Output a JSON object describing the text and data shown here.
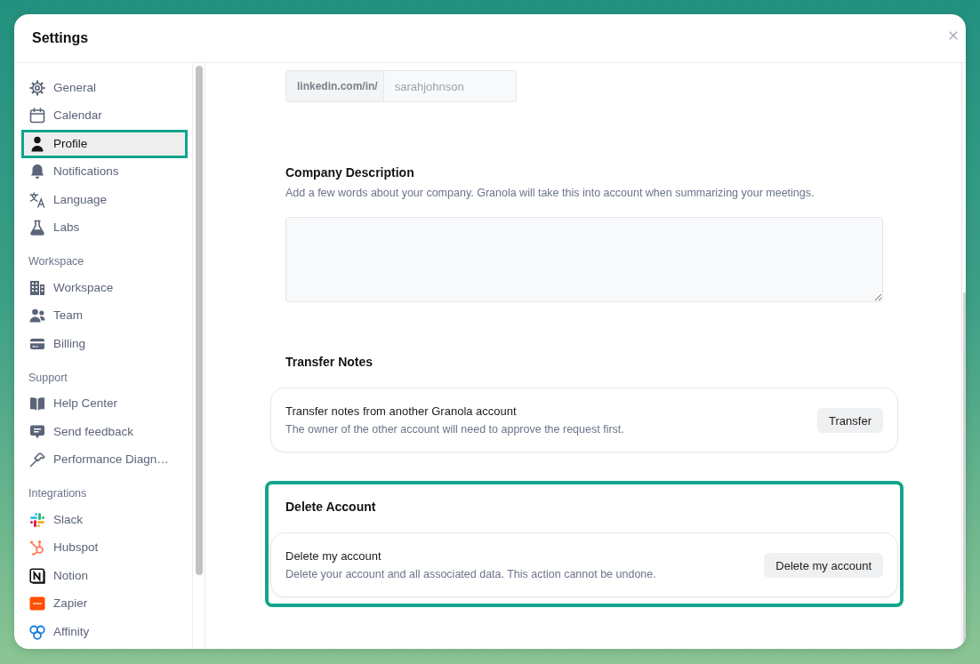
{
  "window": {
    "title": "Settings"
  },
  "sidebar": {
    "sections": [
      {
        "items": [
          {
            "label": "General",
            "selected": false,
            "highlighted": false
          },
          {
            "label": "Calendar",
            "selected": false,
            "highlighted": false
          },
          {
            "label": "Profile",
            "selected": true,
            "highlighted": true
          },
          {
            "label": "Notifications",
            "selected": false,
            "highlighted": false
          },
          {
            "label": "Language",
            "selected": false,
            "highlighted": false
          },
          {
            "label": "Labs",
            "selected": false,
            "highlighted": false
          }
        ]
      },
      {
        "heading": "Workspace",
        "items": [
          {
            "label": "Workspace",
            "selected": false,
            "highlighted": false
          },
          {
            "label": "Team",
            "selected": false,
            "highlighted": false
          },
          {
            "label": "Billing",
            "selected": false,
            "highlighted": false
          }
        ]
      },
      {
        "heading": "Support",
        "items": [
          {
            "label": "Help Center",
            "selected": false,
            "highlighted": false
          },
          {
            "label": "Send feedback",
            "selected": false,
            "highlighted": false
          },
          {
            "label": "Performance Diagn…",
            "selected": false,
            "highlighted": false
          }
        ]
      },
      {
        "heading": "Integrations",
        "items": [
          {
            "label": "Slack",
            "selected": false,
            "highlighted": false
          },
          {
            "label": "Hubspot",
            "selected": false,
            "highlighted": false
          },
          {
            "label": "Notion",
            "selected": false,
            "highlighted": false
          },
          {
            "label": "Zapier",
            "selected": false,
            "highlighted": false
          },
          {
            "label": "Affinity",
            "selected": false,
            "highlighted": false
          }
        ]
      }
    ]
  },
  "profile": {
    "linkedin_field": {
      "prefix": "linkedin.com/in/",
      "placeholder": "sarahjohnson"
    },
    "company_description": {
      "title": "Company Description",
      "description": "Add a few words about your company. Granola will take this into account when summarizing your meetings."
    },
    "action_sections": [
      {
        "title": "Transfer Notes",
        "highlighted": false,
        "card": {
          "title": "Transfer notes from another Granola account",
          "description": "The owner of the other account will need to approve the request first.",
          "button": "Transfer"
        }
      },
      {
        "title": "Delete Account",
        "highlighted": true,
        "card": {
          "title": "Delete my account",
          "description": "Delete your account and all associated data. This action cannot be undone.",
          "button": "Delete my account"
        }
      }
    ]
  }
}
